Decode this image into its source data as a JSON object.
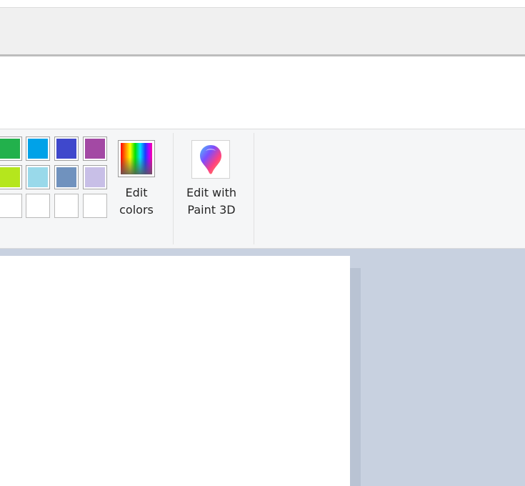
{
  "ribbon": {
    "colors": {
      "row1": [
        {
          "name": "green",
          "color": "#22b14c"
        },
        {
          "name": "turquoise",
          "color": "#00a2e8"
        },
        {
          "name": "indigo",
          "color": "#3f48cc"
        },
        {
          "name": "purple",
          "color": "#a349a4"
        }
      ],
      "row2": [
        {
          "name": "lime",
          "color": "#b5e61d"
        },
        {
          "name": "light-turquoise",
          "color": "#99d9ea"
        },
        {
          "name": "blue-gray",
          "color": "#7092be"
        },
        {
          "name": "lavender",
          "color": "#c8bfe7"
        }
      ],
      "row3_custom_slots": 4
    },
    "edit_colors": {
      "label_line1": "Edit",
      "label_line2": "colors",
      "icon": "rainbow-spectrum-icon"
    },
    "edit_paint3d": {
      "label_line1": "Edit with",
      "label_line2": "Paint 3D",
      "icon": "paint3d-icon"
    }
  },
  "workspace": {
    "background": "#c8d1e0",
    "canvas_color": "#ffffff"
  }
}
